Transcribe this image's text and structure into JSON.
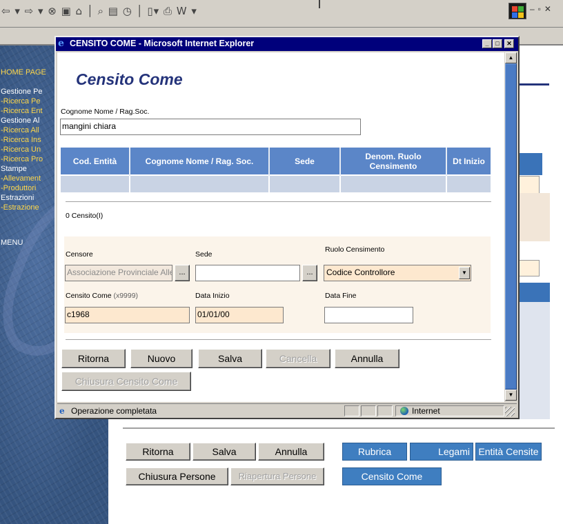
{
  "background": {
    "sidebar": {
      "items": [
        {
          "label": "HOME PAGE",
          "style": "yellow"
        },
        {
          "label": "",
          "style": "white"
        },
        {
          "label": "Gestione Pe",
          "style": "white"
        },
        {
          "label": "-Ricerca Pe",
          "style": "yellow"
        },
        {
          "label": "-Ricerca Ent",
          "style": "yellow"
        },
        {
          "label": "Gestione Al",
          "style": "white"
        },
        {
          "label": "-Ricerca All",
          "style": "yellow"
        },
        {
          "label": "-Ricerca Ins",
          "style": "yellow"
        },
        {
          "label": "-Ricerca Un",
          "style": "yellow"
        },
        {
          "label": "-Ricerca Pro",
          "style": "yellow"
        },
        {
          "label": "Stampe",
          "style": "white"
        },
        {
          "label": "-Allevament",
          "style": "yellow"
        },
        {
          "label": "-Produttori",
          "style": "yellow"
        },
        {
          "label": "Estrazioni",
          "style": "white"
        },
        {
          "label": "-Estrazione",
          "style": "yellow"
        }
      ],
      "menu_label": "MENU"
    },
    "buttons": {
      "ritorna": "Ritorna",
      "salva": "Salva",
      "annulla": "Annulla",
      "chiusura_persone": "Chiusura Persone",
      "riapertura_persone": "Riapertura Persone",
      "rubrica": "Rubrica",
      "legami": "Legami",
      "entita_censite": "Entità Censite",
      "censito_come": "Censito Come"
    }
  },
  "popup": {
    "window_title": "CENSITO COME - Microsoft Internet Explorer",
    "page_title": "Censito Come",
    "search": {
      "label": "Cognome Nome / Rag.Soc.",
      "value": "mangini chiara"
    },
    "table": {
      "headers": [
        "Cod. Entità",
        "Cognome Nome / Rag. Soc.",
        "Sede",
        "Denom. Ruolo Censimento",
        "Dt Inizio"
      ]
    },
    "result_count": "0 Censito(I)",
    "form": {
      "censore_label": "Censore",
      "censore_value": "Associazione Provinciale Alle",
      "sede_label": "Sede",
      "sede_value": "",
      "ruolo_label": "Ruolo Censimento",
      "ruolo_value": "Codice Controllore",
      "censito_come_label": "Censito Come",
      "censito_come_hint": "(x9999)",
      "censito_come_value": "c1968",
      "data_inizio_label": "Data Inizio",
      "data_inizio_value": "01/01/00",
      "data_fine_label": "Data Fine",
      "data_fine_value": "",
      "lookup_label": "..."
    },
    "buttons": {
      "ritorna": "Ritorna",
      "nuovo": "Nuovo",
      "salva": "Salva",
      "cancella": "Cancella",
      "annulla": "Annulla",
      "chiusura": "Chiusura Censito Come"
    },
    "status": {
      "text": "Operazione completata",
      "zone": "Internet"
    }
  }
}
